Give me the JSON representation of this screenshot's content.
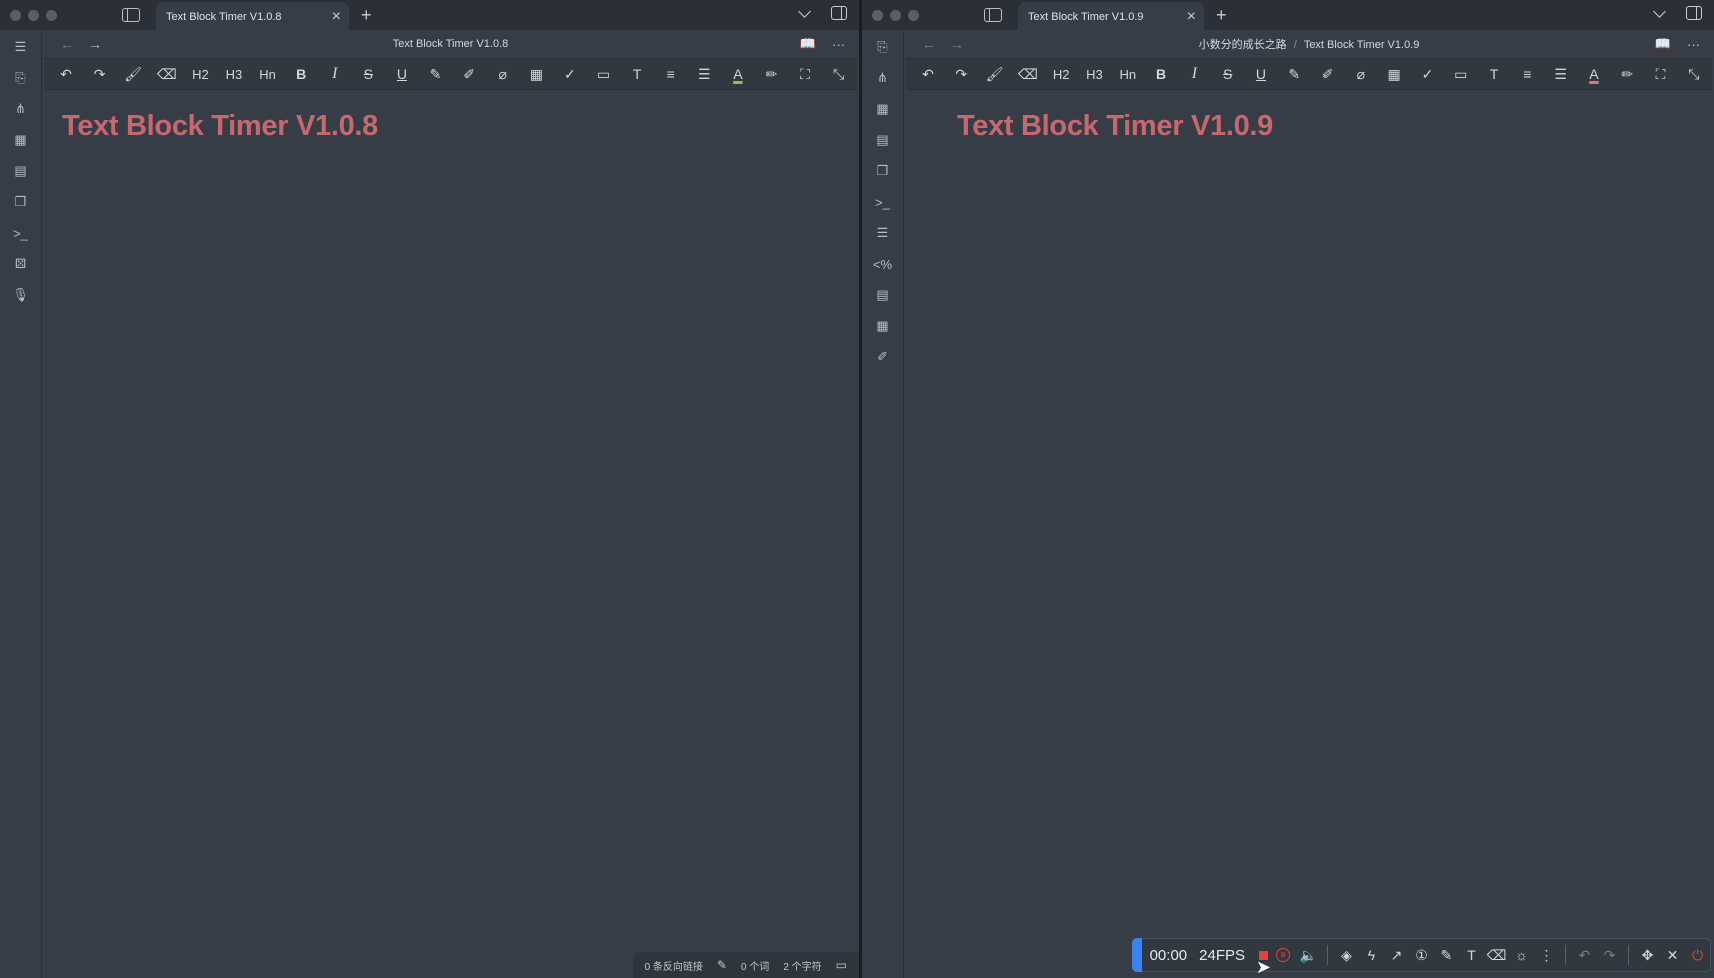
{
  "left_window": {
    "tab_title": "Text Block Timer V1.0.8",
    "nav_title": "Text Block Timer V1.0.8",
    "doc_title": "Text Block Timer V1.0.8",
    "status": {
      "backlinks": "0 条反向链接",
      "words": "0 个词",
      "chars": "2 个字符"
    }
  },
  "right_window": {
    "tab_title": "Text Block Timer V1.0.9",
    "breadcrumb_folder": "小数分的成长之路",
    "breadcrumb_sep": "/",
    "breadcrumb_file": "Text Block Timer V1.0.9",
    "doc_title": "Text Block Timer V1.0.9"
  },
  "toolbar": {
    "h2": "H2",
    "h3": "H3",
    "hn": "Hn",
    "bold": "B",
    "italic": "I",
    "strike": "S",
    "underline": "U",
    "text_color": "A"
  },
  "recorder": {
    "time": "00:00",
    "fps": "24FPS"
  },
  "colors": {
    "title": "#c9676f",
    "accent": "#3b82f6",
    "record": "#e5413a",
    "text_color_underline": "#8bc34a",
    "text_color_underline_right": "#e07878"
  }
}
